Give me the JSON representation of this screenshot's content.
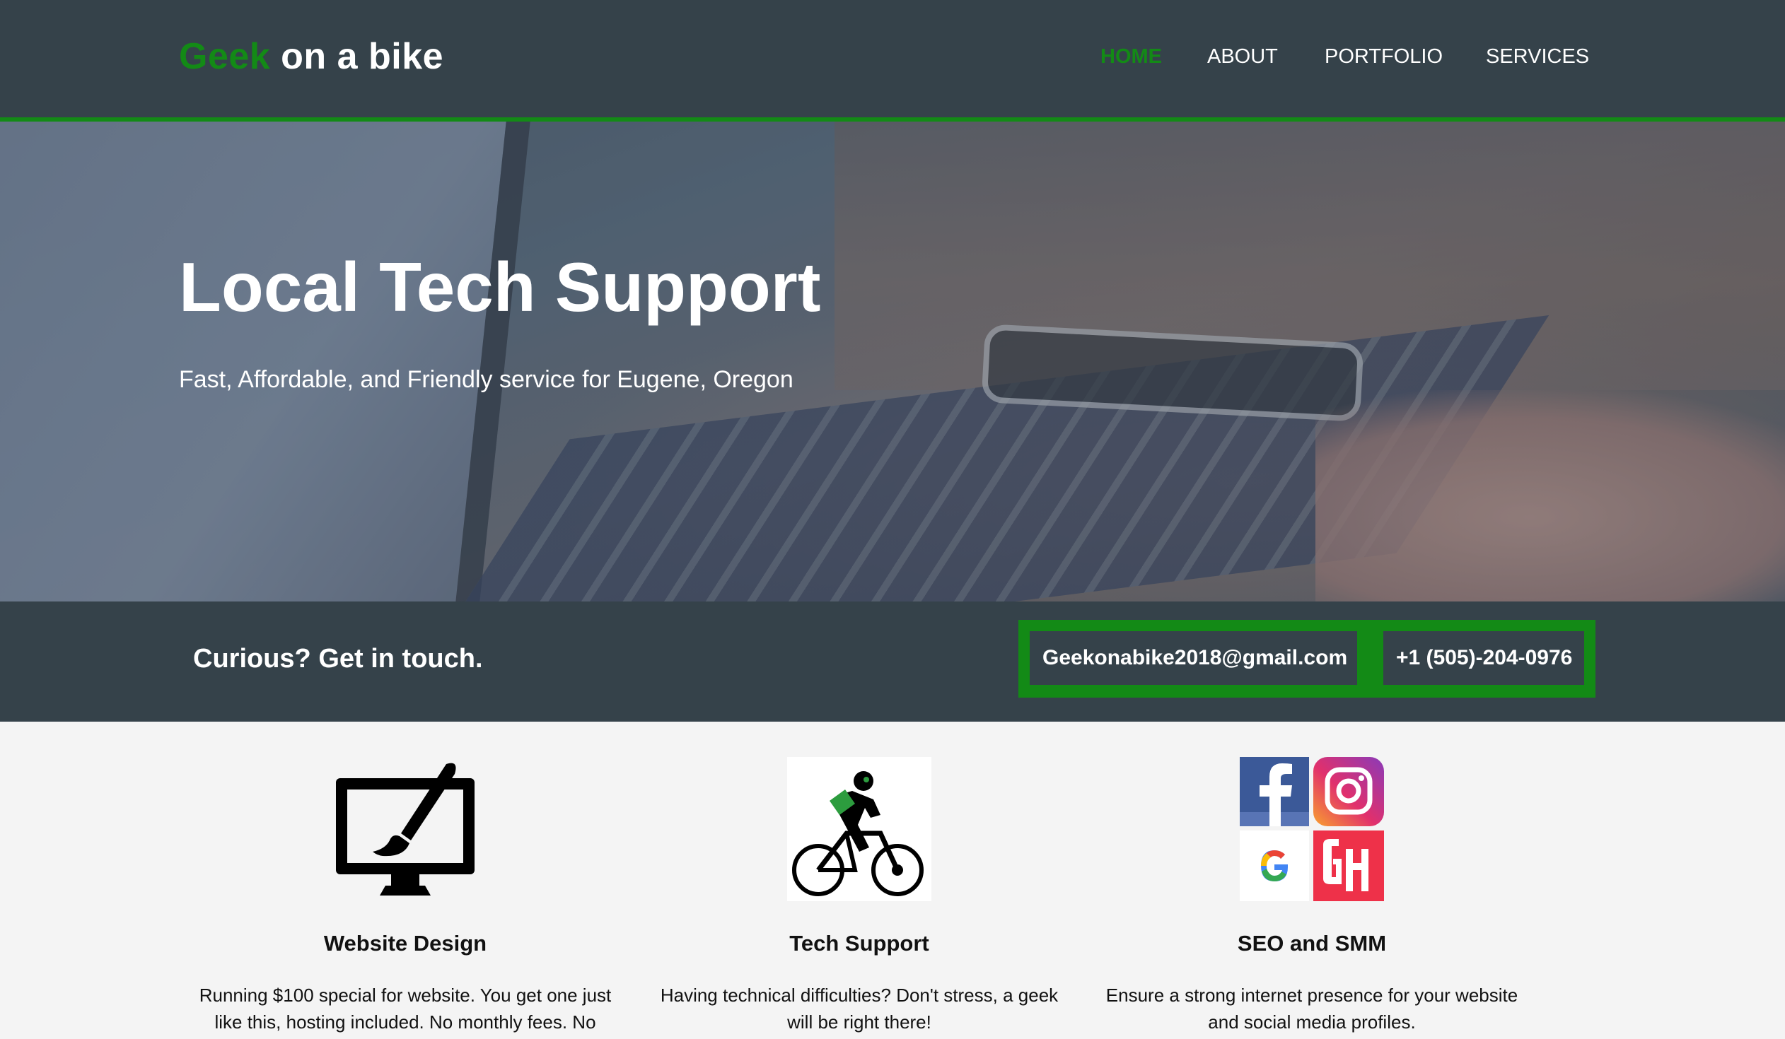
{
  "header": {
    "logo_accent": "Geek",
    "logo_rest": " on a bike",
    "nav": [
      {
        "label": "HOME",
        "active": true
      },
      {
        "label": "ABOUT",
        "active": false
      },
      {
        "label": "PORTFOLIO",
        "active": false
      },
      {
        "label": "SERVICES",
        "active": false
      }
    ]
  },
  "hero": {
    "title": "Local Tech Support",
    "subtitle": "Fast, Affordable, and Friendly service for Eugene, Oregon"
  },
  "contact": {
    "heading": "Curious? Get in touch.",
    "email": "Geekonabike2018@gmail.com",
    "phone": "+1 (505)-204-0976"
  },
  "services": [
    {
      "icon": "monitor-paintbrush-icon",
      "title": "Website Design",
      "text": "Running $100 special for website. You get one just like this, hosting included. No monthly fees. No"
    },
    {
      "icon": "cyclist-icon",
      "title": "Tech Support",
      "text": "Having technical difficulties? Don't stress, a geek will be right there!"
    },
    {
      "icon": "social-media-icons",
      "title": "SEO and SMM",
      "text": "Ensure a strong internet presence for your website and social media profiles."
    }
  ],
  "colors": {
    "accent": "#138a16",
    "header_bg": "#35424a",
    "body_bg": "#f4f4f4"
  }
}
